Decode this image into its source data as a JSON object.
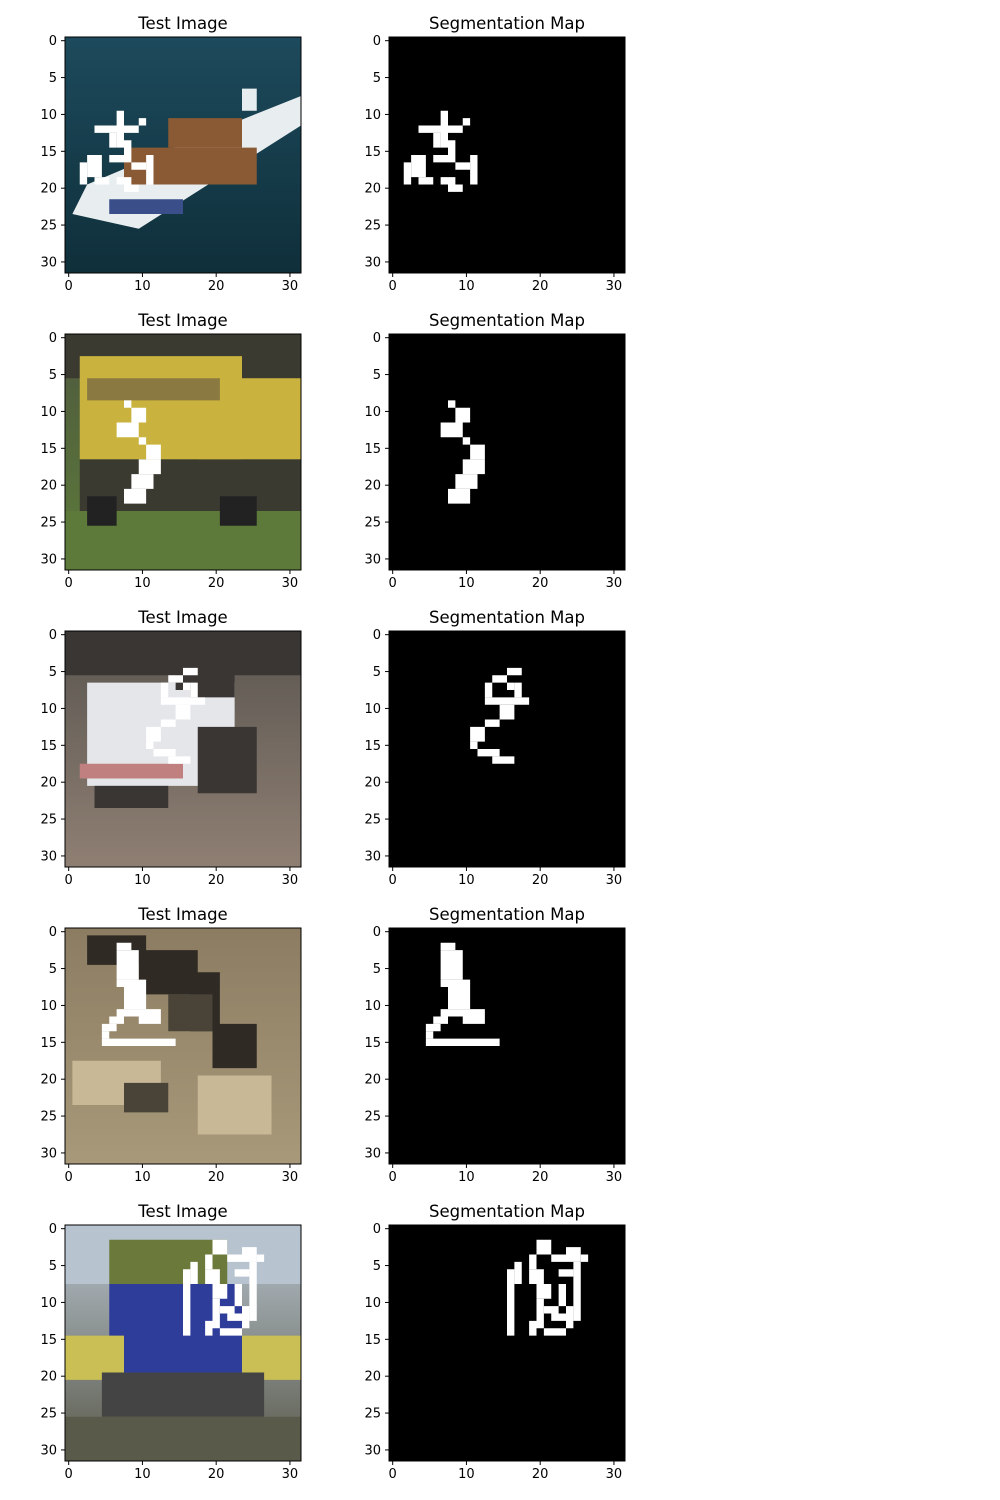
{
  "chart_data": {
    "type": "image-grid",
    "panel_count_per_row": 2,
    "xlim": [
      -0.5,
      31.5
    ],
    "ylim": [
      31.5,
      -0.5
    ],
    "xticks": [
      0,
      10,
      20,
      30
    ],
    "yticks": [
      0,
      5,
      10,
      15,
      20,
      25,
      30
    ],
    "colors": {
      "mask_on": "#ffffff",
      "mask_off": "#000000",
      "axis": "#000000"
    },
    "rows": [
      {
        "test_image": {
          "title": "Test Image",
          "scene": "boat",
          "palette": {
            "bg_top": "#1d4a5c",
            "bg_bottom": "#0f2f3a",
            "object": "#e8eef0",
            "object_accent": "#8a5a35",
            "object_shadow": "#3a4f8a"
          }
        },
        "segmentation_map": {
          "title": "Segmentation Map",
          "mask": [
            [
              7,
              8,
              10,
              15
            ],
            [
              10,
              11,
              11,
              12
            ],
            [
              4,
              10,
              12,
              13
            ],
            [
              6,
              7,
              13,
              15
            ],
            [
              8,
              9,
              14,
              16
            ],
            [
              3,
              5,
              16,
              19
            ],
            [
              6,
              9,
              16,
              17
            ],
            [
              9,
              11,
              17,
              18
            ],
            [
              11,
              12,
              16,
              20
            ],
            [
              4,
              6,
              19,
              20
            ],
            [
              7,
              9,
              19,
              20
            ],
            [
              8,
              10,
              20,
              21
            ],
            [
              2,
              3,
              17,
              20
            ]
          ]
        }
      },
      {
        "test_image": {
          "title": "Test Image",
          "scene": "truck",
          "palette": {
            "bg_top": "#4f5a3e",
            "bg_bottom": "#5d7a3a",
            "object": "#c9b23d",
            "object_accent": "#8a7a42",
            "object_shadow": "#3b3a30"
          }
        },
        "segmentation_map": {
          "title": "Segmentation Map",
          "mask": [
            [
              8,
              9,
              9,
              10
            ],
            [
              9,
              11,
              10,
              12
            ],
            [
              7,
              10,
              12,
              14
            ],
            [
              10,
              11,
              14,
              15
            ],
            [
              11,
              13,
              15,
              17
            ],
            [
              10,
              13,
              17,
              19
            ],
            [
              9,
              12,
              19,
              21
            ],
            [
              8,
              11,
              21,
              23
            ]
          ]
        }
      },
      {
        "test_image": {
          "title": "Test Image",
          "scene": "car",
          "palette": {
            "bg_top": "#5a5650",
            "bg_bottom": "#8f7f73",
            "object": "#e4e6ea",
            "object_accent": "#c08080",
            "object_shadow": "#3a3634"
          }
        },
        "segmentation_map": {
          "title": "Segmentation Map",
          "mask": [
            [
              16,
              18,
              5,
              6
            ],
            [
              14,
              16,
              6,
              7
            ],
            [
              13,
              14,
              7,
              9
            ],
            [
              16,
              17,
              7,
              8
            ],
            [
              17,
              18,
              7,
              9
            ],
            [
              13,
              19,
              9,
              10
            ],
            [
              15,
              17,
              10,
              12
            ],
            [
              13,
              15,
              12,
              13
            ],
            [
              11,
              13,
              13,
              15
            ],
            [
              11,
              12,
              15,
              16
            ],
            [
              12,
              15,
              16,
              17
            ],
            [
              14,
              17,
              17,
              18
            ]
          ]
        }
      },
      {
        "test_image": {
          "title": "Test Image",
          "scene": "rocky ground",
          "palette": {
            "bg_top": "#8c7c62",
            "bg_bottom": "#a8997a",
            "object": "#c8b896",
            "object_accent": "#4a4438",
            "object_shadow": "#2f2a24"
          }
        },
        "segmentation_map": {
          "title": "Segmentation Map",
          "mask": [
            [
              7,
              9,
              2,
              3
            ],
            [
              7,
              10,
              3,
              7
            ],
            [
              7,
              11,
              7,
              8
            ],
            [
              8,
              11,
              8,
              11
            ],
            [
              7,
              13,
              11,
              12
            ],
            [
              6,
              8,
              12,
              13
            ],
            [
              10,
              13,
              12,
              13
            ],
            [
              5,
              7,
              13,
              14
            ],
            [
              5,
              6,
              14,
              15
            ],
            [
              5,
              15,
              15,
              16
            ]
          ]
        }
      },
      {
        "test_image": {
          "title": "Test Image",
          "scene": "truck",
          "palette": {
            "bg_top": "#b7c3cf",
            "bg_bottom": "#5a5a4a",
            "object": "#2f3d9a",
            "object_accent": "#c9bf55",
            "object_shadow": "#6b7a3a"
          }
        },
        "segmentation_map": {
          "title": "Segmentation Map",
          "mask": [
            [
              20,
              22,
              2,
              4
            ],
            [
              24,
              26,
              3,
              5
            ],
            [
              19,
              20,
              4,
              6
            ],
            [
              22,
              24,
              4,
              5
            ],
            [
              26,
              27,
              4,
              5
            ],
            [
              17,
              18,
              5,
              8
            ],
            [
              16,
              17,
              6,
              15
            ],
            [
              19,
              21,
              6,
              8
            ],
            [
              23,
              25,
              6,
              7
            ],
            [
              25,
              26,
              5,
              12
            ],
            [
              20,
              22,
              8,
              10
            ],
            [
              23,
              24,
              8,
              11
            ],
            [
              20,
              21,
              10,
              14
            ],
            [
              21,
              23,
              11,
              12
            ],
            [
              24,
              25,
              11,
              14
            ],
            [
              22,
              24,
              12,
              13
            ],
            [
              21,
              24,
              14,
              15
            ],
            [
              25,
              26,
              12,
              13
            ],
            [
              19,
              20,
              13,
              15
            ]
          ]
        }
      }
    ]
  }
}
